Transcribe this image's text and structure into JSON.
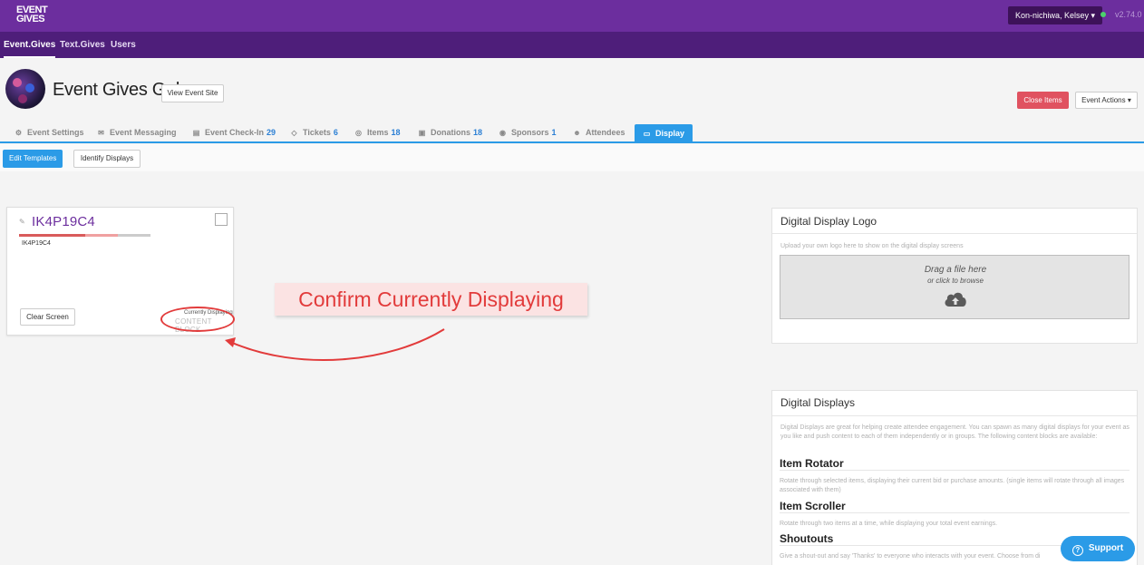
{
  "topbar": {
    "logo_line1": "EVENT",
    "logo_line2": "GIVES",
    "user_label": "Kon-nichiwa,  Kelsey ▾",
    "version": "v2.74.0"
  },
  "nav": {
    "items": [
      {
        "label": "Event.Gives"
      },
      {
        "label": "Text.Gives"
      },
      {
        "label": "Users"
      }
    ]
  },
  "header": {
    "title": "Event Gives Gala",
    "view_site_label": "View Event Site",
    "close_items_label": "Close Items",
    "event_actions_label": "Event Actions ▾"
  },
  "tabs": [
    {
      "icon": "gear-icon",
      "glyph": "⚙",
      "label": "Event Settings",
      "count": ""
    },
    {
      "icon": "envelope-icon",
      "glyph": "✉",
      "label": "Event Messaging",
      "count": ""
    },
    {
      "icon": "checkin-icon",
      "glyph": "▤",
      "label": "Event Check-In",
      "count": "29"
    },
    {
      "icon": "ticket-icon",
      "glyph": "◇",
      "label": "Tickets",
      "count": "6"
    },
    {
      "icon": "item-icon",
      "glyph": "◎",
      "label": "Items",
      "count": "18"
    },
    {
      "icon": "donation-icon",
      "glyph": "▣",
      "label": "Donations",
      "count": "18"
    },
    {
      "icon": "sponsor-icon",
      "glyph": "◉",
      "label": "Sponsors",
      "count": "1"
    },
    {
      "icon": "attendees-icon",
      "glyph": "☻",
      "label": "Attendees",
      "count": ""
    },
    {
      "icon": "monitor-icon",
      "glyph": "▭",
      "label": "Display",
      "count": ""
    }
  ],
  "subbar": {
    "edit_templates_label": "Edit Templates",
    "identify_displays_label": "Identify Displays"
  },
  "display_card": {
    "code": "IK4P19C4",
    "sub_code": "IK4P19C4",
    "clear_screen_label": "Clear Screen",
    "currently_label": "Currently Displaying",
    "content_label": "CONTENT BLOCK"
  },
  "callout": {
    "text": "Confirm Currently Displaying"
  },
  "logo_panel": {
    "title": "Digital Display Logo",
    "help": "Upload your own logo here to show on the digital display screens",
    "drop_main": "Drag a file here",
    "drop_sub": "or click to browse"
  },
  "displays_panel": {
    "title": "Digital Displays",
    "intro": "Digital Displays are great for helping create attendee engagement. You can spawn as many digital displays for your event as you like and push content to each of them independently or in groups. The following content blocks are available:",
    "blocks": [
      {
        "name": "Item Rotator",
        "desc": "Rotate through selected items, displaying their current bid or purchase amounts. (single items will rotate through all images associated with them)"
      },
      {
        "name": "Item Scroller",
        "desc": "Rotate through two items at a time, while displaying your total event earnings."
      },
      {
        "name": "Shoutouts",
        "desc": "Give a shout-out and say 'Thanks' to everyone who interacts with your event. Choose from di"
      }
    ]
  },
  "support": {
    "label": "Support"
  },
  "colors": {
    "topbar": "#6c2e9e",
    "navbar": "#4e1e7a",
    "accent_blue": "#2b9be7",
    "danger": "#e05260",
    "callout_red": "#e23b3b"
  }
}
